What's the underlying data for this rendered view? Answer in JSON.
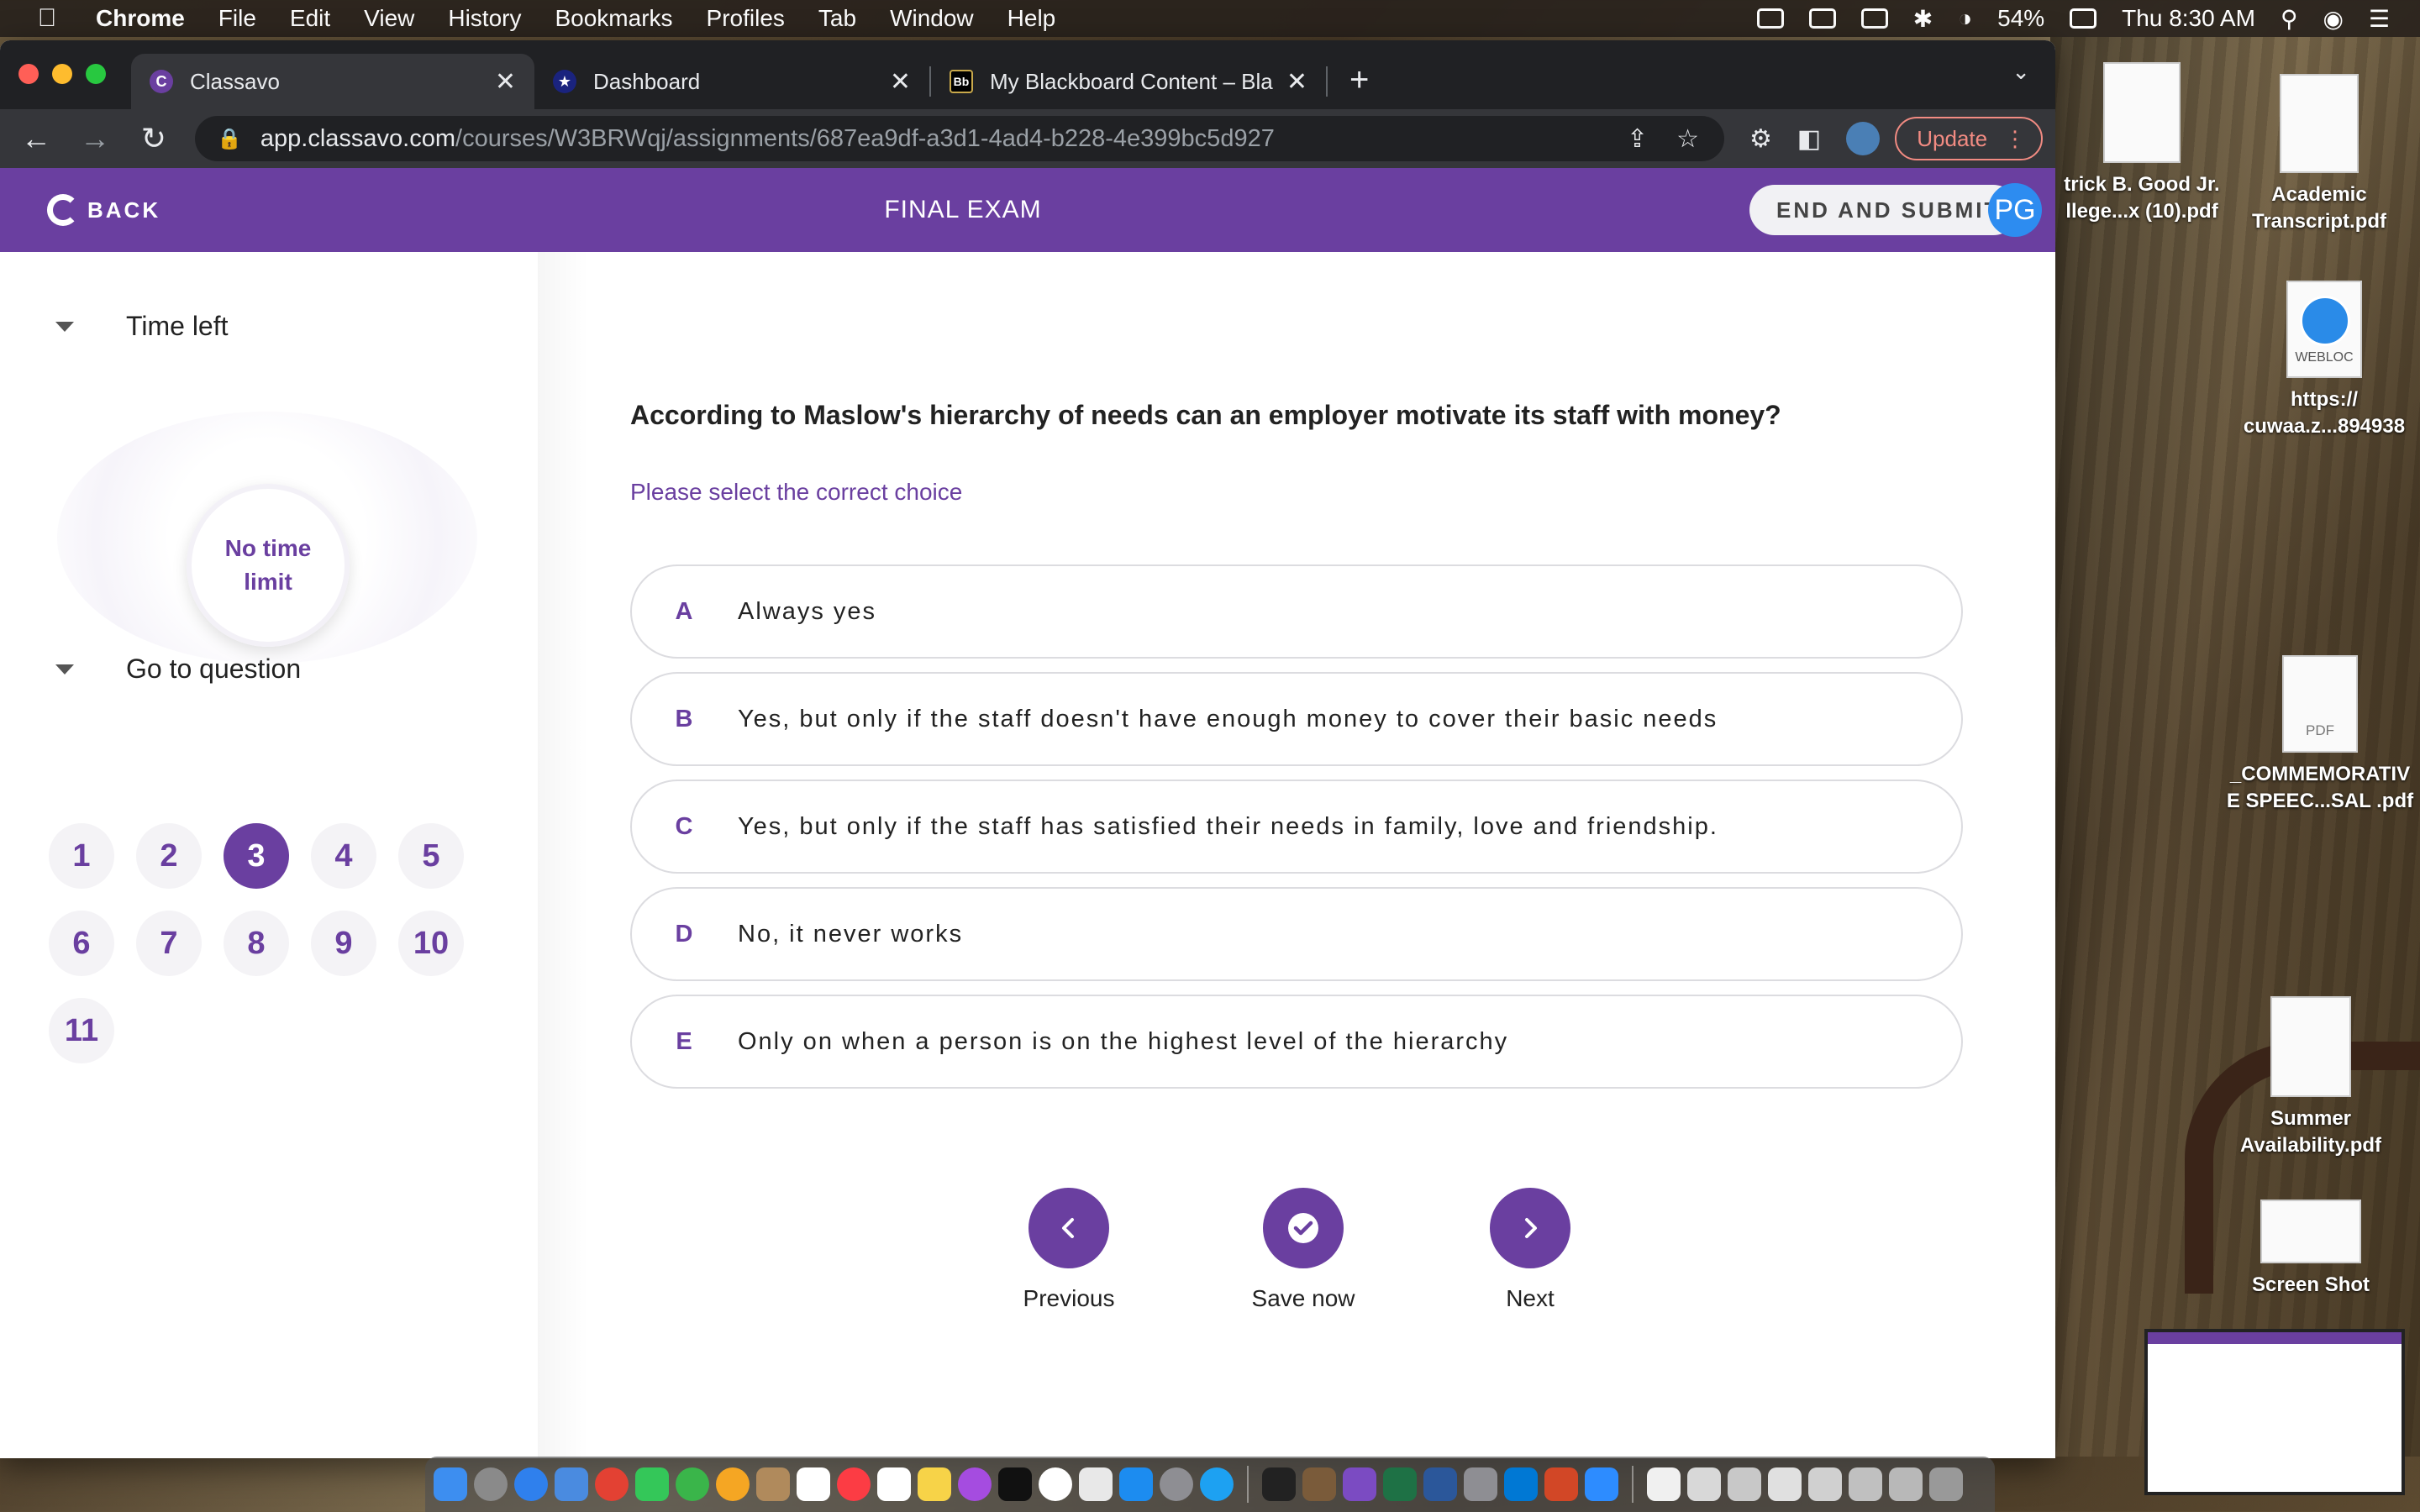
{
  "menubar": {
    "app": "Chrome",
    "items": [
      "File",
      "Edit",
      "View",
      "History",
      "Bookmarks",
      "Profiles",
      "Tab",
      "Window",
      "Help"
    ],
    "battery": "54%",
    "clock": "Thu 8:30 AM"
  },
  "browser": {
    "tabs": [
      {
        "title": "Classavo",
        "icon": "classavo-favicon"
      },
      {
        "title": "Dashboard",
        "icon": "star-favicon"
      },
      {
        "title": "My Blackboard Content – Black",
        "icon": "blackboard-favicon"
      }
    ],
    "url_host": "app.classavo.com",
    "url_path": "/courses/W3BRWqj/assignments/687ea9df-a3d1-4ad4-b228-4e399bc5d927",
    "update_label": "Update"
  },
  "app": {
    "back_label": "BACK",
    "exam_title": "FINAL EXAM",
    "end_submit_label": "END AND SUBMIT",
    "user_initials": "PG"
  },
  "sidebar": {
    "time_left_label": "Time left",
    "time_value": "No time limit",
    "goto_label": "Go to question",
    "questions": [
      "1",
      "2",
      "3",
      "4",
      "5",
      "6",
      "7",
      "8",
      "9",
      "10",
      "11"
    ],
    "current_question": "3"
  },
  "question": {
    "text": "According to Maslow's hierarchy of needs can an employer motivate its staff with money?",
    "hint": "Please select the correct choice",
    "options": [
      {
        "letter": "A",
        "text": "Always yes"
      },
      {
        "letter": "B",
        "text": "Yes, but only if the staff doesn't have enough money to cover their basic needs"
      },
      {
        "letter": "C",
        "text": "Yes, but only if the staff has satisfied their needs in family, love and friendship."
      },
      {
        "letter": "D",
        "text": "No, it never works"
      },
      {
        "letter": "E",
        "text": "Only on when a person is on the highest level of the hierarchy"
      }
    ]
  },
  "nav": {
    "previous_label": "Previous",
    "save_label": "Save now",
    "next_label": "Next"
  },
  "desktop": {
    "icons": [
      {
        "label": "trick B. Good Jr. llege...x (10).pdf"
      },
      {
        "label": "Academic Transcript.pdf"
      },
      {
        "label": "https:// cuwaa.z...894938",
        "badge": "WEBLOC"
      },
      {
        "label": "_COMMEMORATIV E SPEEC...SAL .pdf",
        "badge": "PDF"
      },
      {
        "label": "Summer Availability.pdf"
      },
      {
        "label": "Screen Shot"
      }
    ]
  },
  "colors": {
    "brand": "#6a3fa0",
    "avatar": "#2d8cf0"
  }
}
